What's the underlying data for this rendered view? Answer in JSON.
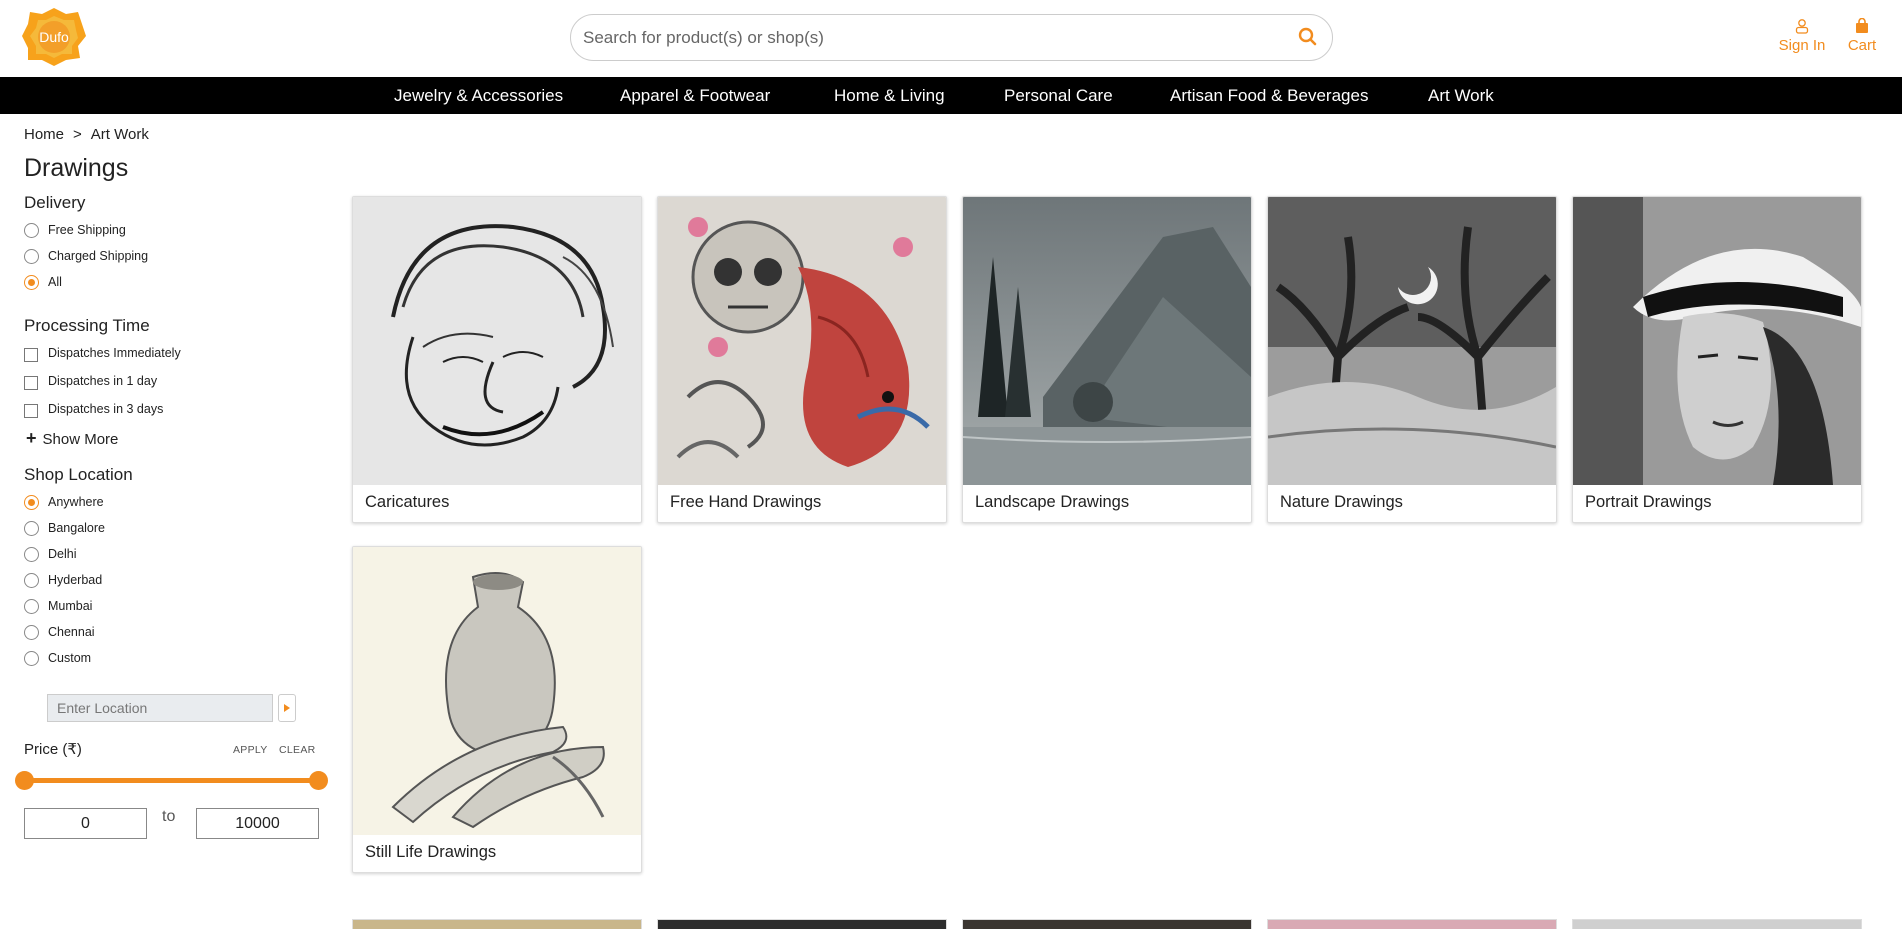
{
  "brand": {
    "logo_text": "Dufo",
    "accent": "#f28c1e"
  },
  "search": {
    "placeholder": "Search for product(s) or shop(s)",
    "icon": "search-icon"
  },
  "header_links": {
    "signin": "Sign In",
    "cart": "Cart"
  },
  "nav": [
    "Jewelry & Accessories",
    "Apparel & Footwear",
    "Home & Living",
    "Personal Care",
    "Artisan Food & Beverages",
    "Art Work"
  ],
  "breadcrumb": {
    "home": "Home",
    "separator": ">",
    "current": "Art Work"
  },
  "page_title": "Drawings",
  "filters": {
    "delivery": {
      "title": "Delivery",
      "options": [
        "Free Shipping",
        "Charged Shipping",
        "All"
      ],
      "selected": "All"
    },
    "processing": {
      "title": "Processing Time",
      "options": [
        "Dispatches Immediately",
        "Dispatches in 1 day",
        "Dispatches in 3 days"
      ],
      "show_more": "Show More"
    },
    "location": {
      "title": "Shop Location",
      "options": [
        "Anywhere",
        "Bangalore",
        "Delhi",
        "Hyderbad",
        "Mumbai",
        "Chennai",
        "Custom"
      ],
      "selected": "Anywhere",
      "input_placeholder": "Enter Location"
    },
    "price": {
      "title": "Price (₹)",
      "apply": "APPLY",
      "clear": "CLEAR",
      "min": "0",
      "max": "10000",
      "to": "to"
    }
  },
  "categories": [
    {
      "name": "Caricatures"
    },
    {
      "name": "Free Hand Drawings"
    },
    {
      "name": "Landscape Drawings"
    },
    {
      "name": "Nature Drawings"
    },
    {
      "name": "Portrait Drawings"
    },
    {
      "name": "Still Life Drawings"
    }
  ]
}
